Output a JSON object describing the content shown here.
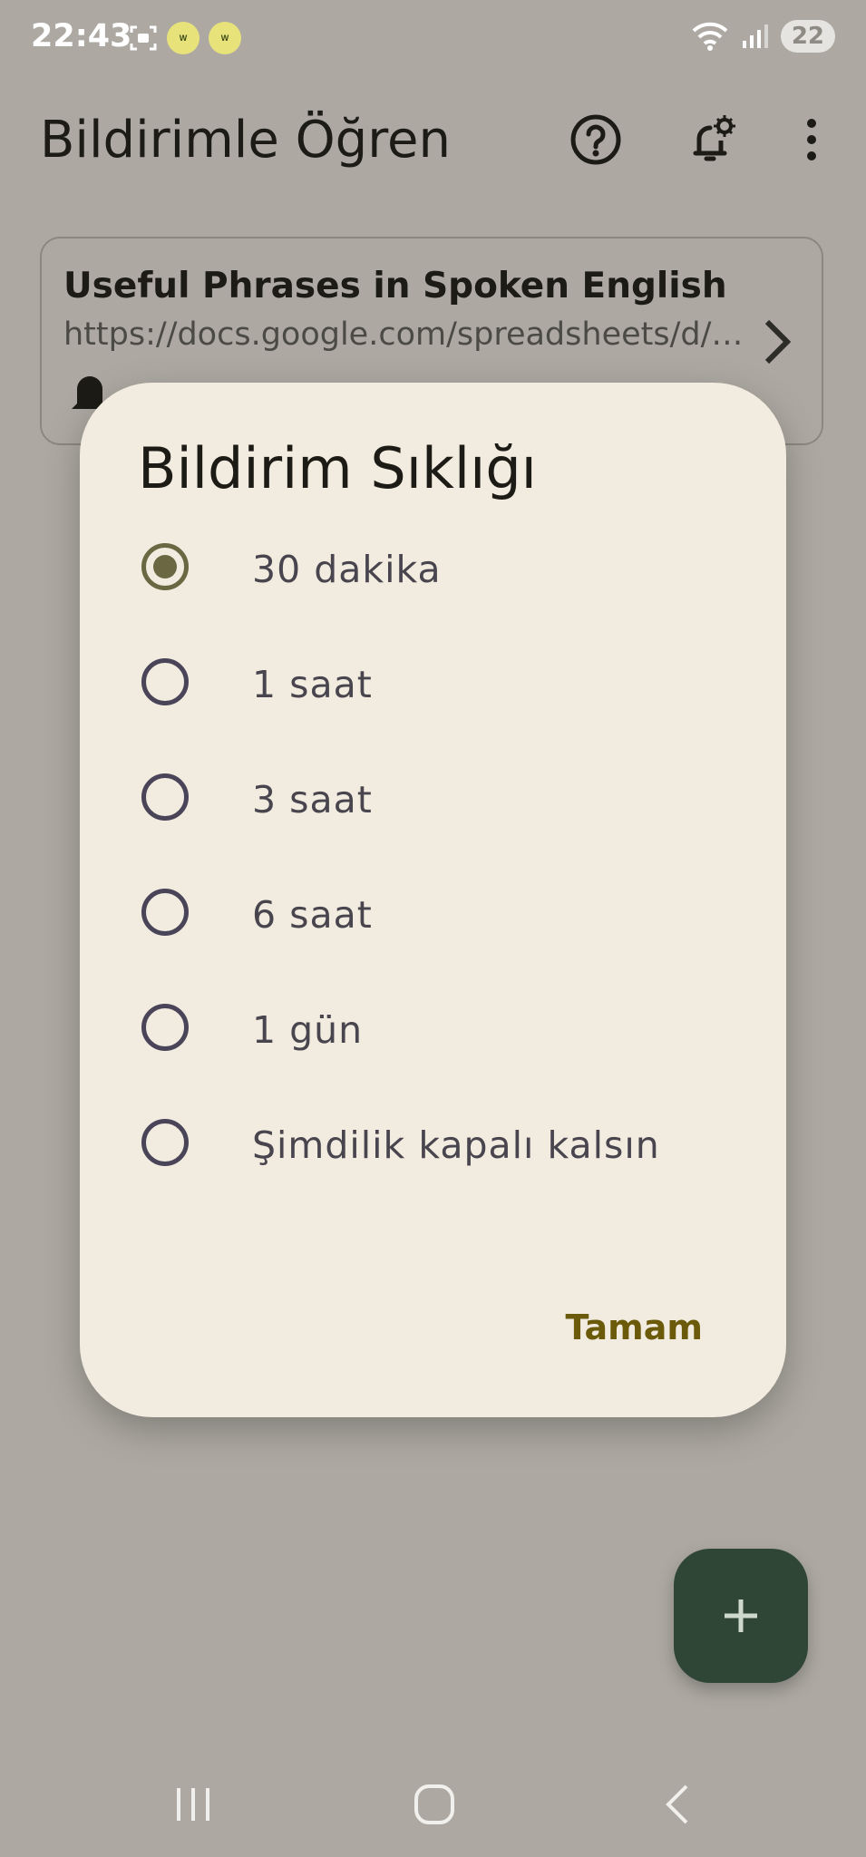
{
  "status_bar": {
    "time": "22:43",
    "battery": "22",
    "icons": [
      "screenshot-icon",
      "word-app-icon",
      "word-app-icon",
      "wifi-icon",
      "signal-icon"
    ]
  },
  "app_bar": {
    "title": "Bildirimle Öğren",
    "actions": [
      "help-icon",
      "notification-settings-icon",
      "more-vert-icon"
    ]
  },
  "sheet_card": {
    "title": "Useful Phrases in Spoken English",
    "url": "https://docs.google.com/spreadsheets/d/…"
  },
  "dialog": {
    "title": "Bildirim Sıklığı",
    "options": [
      {
        "label": "30 dakika",
        "selected": true
      },
      {
        "label": "1 saat",
        "selected": false
      },
      {
        "label": "3 saat",
        "selected": false
      },
      {
        "label": "6 saat",
        "selected": false
      },
      {
        "label": "1 gün",
        "selected": false
      },
      {
        "label": "Şimdilik kapalı kalsın",
        "selected": false
      }
    ],
    "confirm_label": "Tamam"
  },
  "fab": {
    "icon": "add-icon"
  },
  "nav_bar": {
    "buttons": [
      "recents-icon",
      "home-icon",
      "back-icon"
    ]
  },
  "colors": {
    "scrim": "#ada9a2",
    "dialog_bg": "#f2ebdf",
    "accent": "#6b6742",
    "fab_bg": "#2f4636",
    "confirm_text": "#6b5a0a"
  }
}
